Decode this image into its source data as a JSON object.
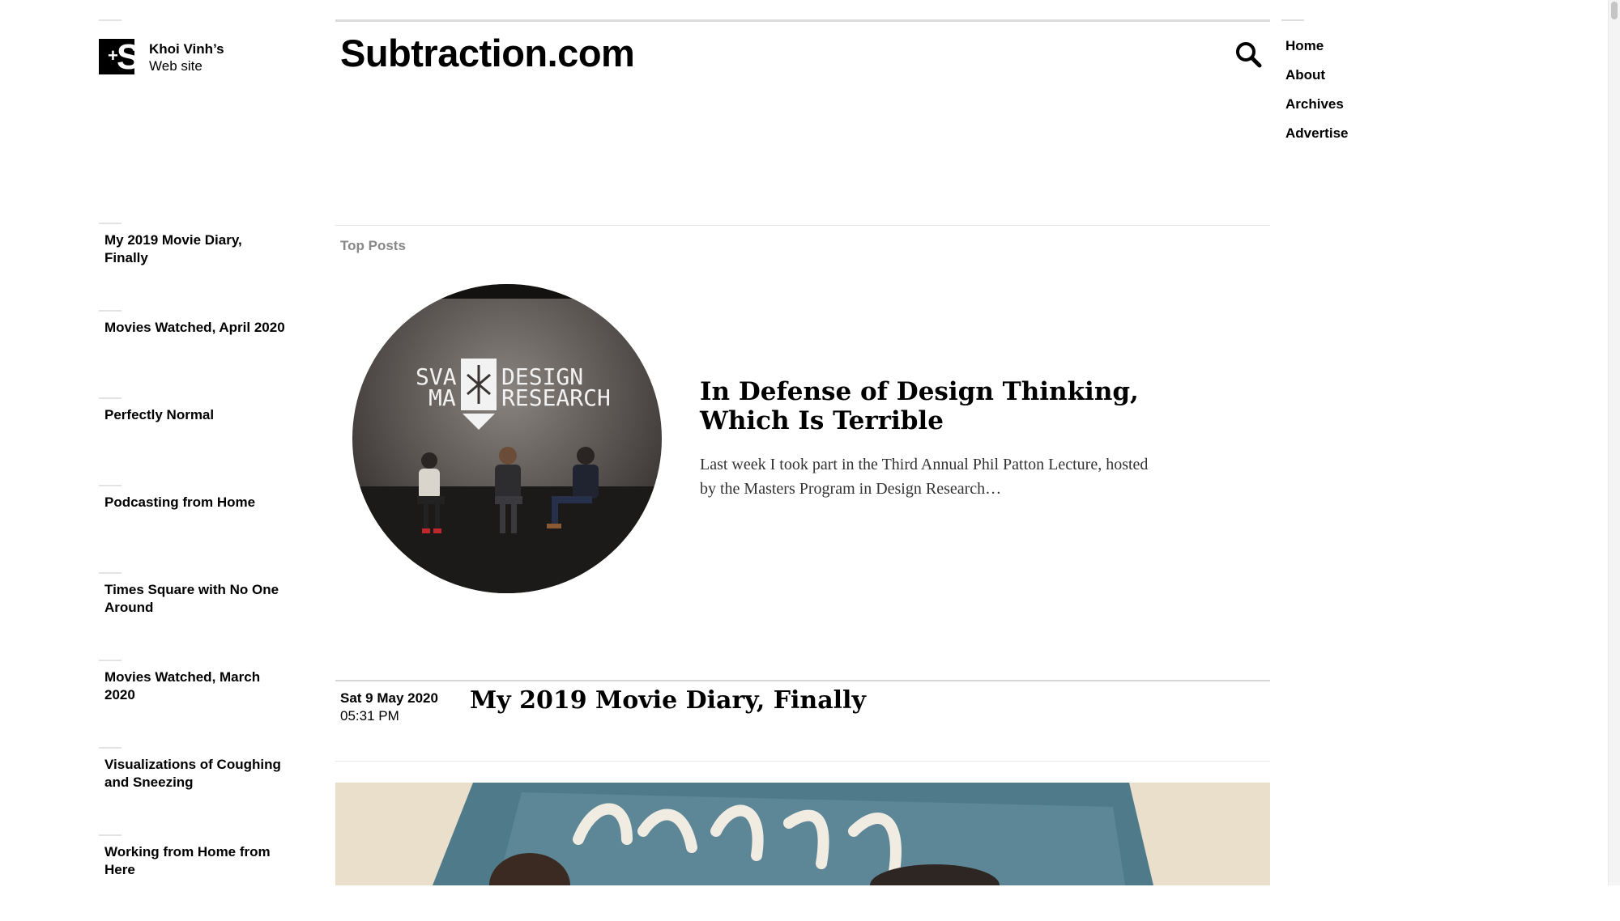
{
  "site": {
    "author": "Khoi Vinh’s",
    "author_sub": "Web site",
    "title": "Subtraction.com",
    "logo_glyphs": {
      "plus": "+",
      "letter": "S"
    }
  },
  "nav": {
    "items": [
      {
        "label": "Home"
      },
      {
        "label": "About"
      },
      {
        "label": "Archives"
      },
      {
        "label": "Advertise"
      }
    ]
  },
  "sidebar": {
    "items": [
      {
        "label": "My 2019 Movie Diary, Finally"
      },
      {
        "label": "Movies Watched, April 2020"
      },
      {
        "label": "Perfectly Normal"
      },
      {
        "label": "Podcasting from Home"
      },
      {
        "label": "Times Square with No One Around"
      },
      {
        "label": "Movies Watched, March 2020"
      },
      {
        "label": "Visualizations of Coughing and Sneezing"
      },
      {
        "label": "Working from Home from Here"
      }
    ]
  },
  "top_posts": {
    "label": "Top Posts",
    "feature": {
      "title": "In Defense of Design Thinking, Which Is Terrible",
      "excerpt": "Last week I took part in the Third Annual Phil Patton Lecture, hosted by the Masters Program in Design Research…",
      "image_text": {
        "left_top": "SVA",
        "left_bottom": "MA",
        "right_top": "DESIGN",
        "right_bottom": "RESEARCH"
      }
    }
  },
  "post": {
    "date": "Sat 9 May 2020",
    "time": "05:31 PM",
    "title": "My 2019 Movie Diary, Finally"
  },
  "icons": {
    "search": "search-icon",
    "logo": "subtraction-logo-icon"
  },
  "colors": {
    "text": "#000000",
    "muted": "#888888",
    "rule": "#dcdcdc"
  }
}
